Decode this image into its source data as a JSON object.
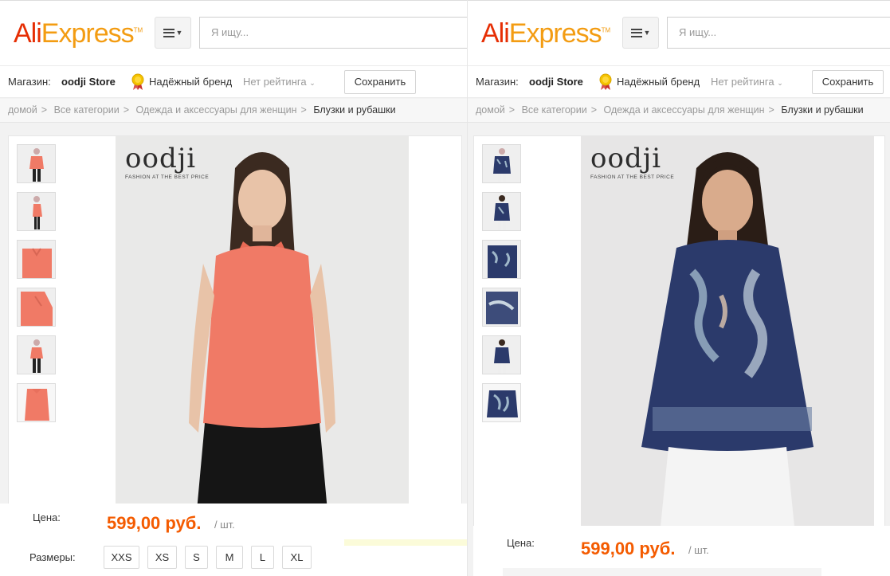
{
  "logo": {
    "part1": "Ali",
    "part2": "Express",
    "tm": "TM"
  },
  "search": {
    "placeholder": "Я ищу..."
  },
  "store": {
    "label": "Магазин:",
    "name": "oodji Store",
    "brand_badge": "Надёжный бренд",
    "rating": "Нет рейтинга",
    "save": "Сохранить"
  },
  "breadcrumb": [
    "домой",
    "Все категории",
    "Одежда и аксессуары для женщин",
    "Блузки и рубашки"
  ],
  "breadcrumb_sep": ">",
  "product_brand": {
    "name": "oodji",
    "tagline": "FASHION AT THE BEST PRICE"
  },
  "price": {
    "label": "Цена:",
    "value": "599,00 руб.",
    "unit": "/ шт."
  },
  "sizes": {
    "label": "Размеры:",
    "items": [
      "XXS",
      "XS",
      "S",
      "M",
      "L",
      "XL"
    ]
  },
  "colors": {
    "ali": "#e62e04",
    "express": "#f39c12",
    "price": "#f45b00",
    "coral_blouse": "#f07a66",
    "navy_blouse": "#2b3a6b"
  },
  "icons": {
    "menu": "hamburger-icon",
    "rating_caret": "chevron-down-icon",
    "badge": "medal-icon"
  }
}
